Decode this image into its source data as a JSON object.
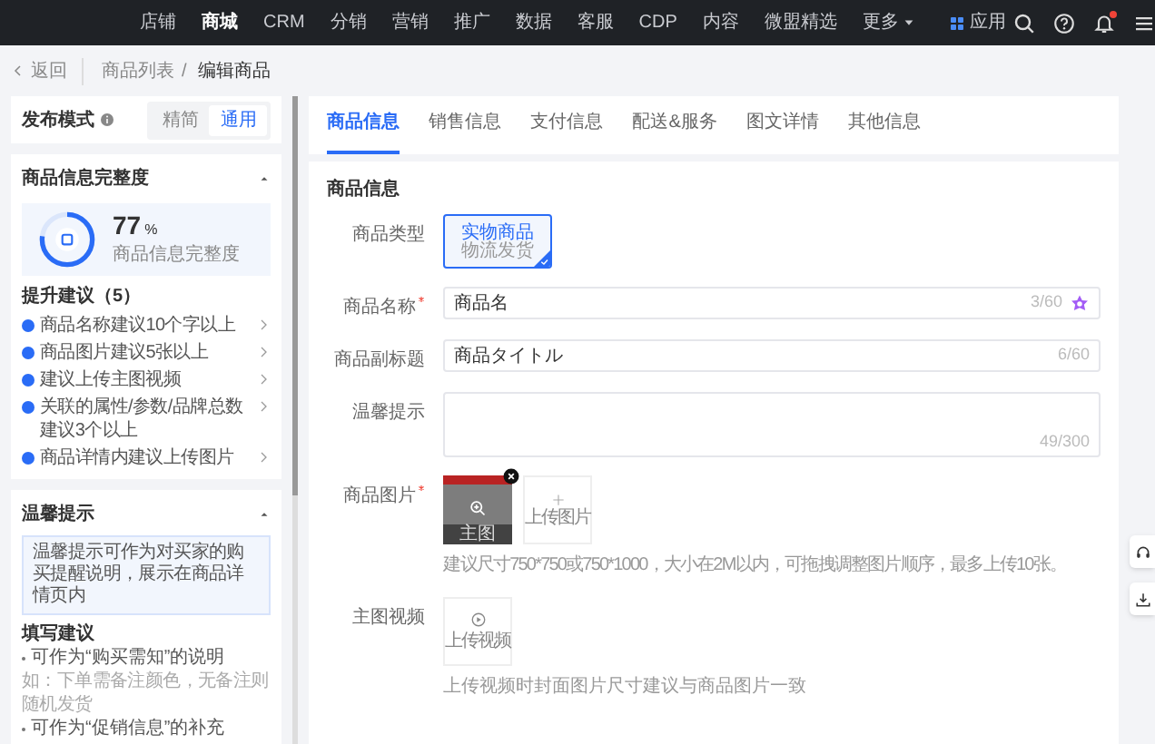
{
  "nav": {
    "items": [
      {
        "label": "店铺",
        "selected": false
      },
      {
        "label": "商城",
        "selected": true
      },
      {
        "label": "CRM",
        "selected": false
      },
      {
        "label": "分销",
        "selected": false
      },
      {
        "label": "营销",
        "selected": false
      },
      {
        "label": "推广",
        "selected": false
      },
      {
        "label": "数据",
        "selected": false
      },
      {
        "label": "客服",
        "selected": false
      },
      {
        "label": "CDP",
        "selected": false
      },
      {
        "label": "内容",
        "selected": false
      },
      {
        "label": "微盟精选",
        "selected": false
      }
    ],
    "more": "更多",
    "apps": "应用",
    "notification_dot": true
  },
  "breadcrumb": {
    "back": "返回",
    "separator": "/",
    "items": [
      "商品列表",
      "编辑商品"
    ]
  },
  "publish_mode": {
    "label": "发布模式",
    "options": [
      {
        "label": "精简",
        "selected": false
      },
      {
        "label": "通用",
        "selected": true
      }
    ]
  },
  "completeness": {
    "title": "商品信息完整度",
    "expanded": true,
    "percent": "77",
    "unit": "%",
    "caption": "商品信息完整度",
    "level": 0.77,
    "suggestions_title": "提升建议（5）",
    "suggestions": [
      "商品名称建议10个字以上",
      "商品图片建议5张以上",
      "建议上传主图视频",
      "关联的属性/参数/品牌总数建议3个以上",
      "商品详情内建议上传图片"
    ]
  },
  "tips": {
    "title": "温馨提示",
    "expanded": true,
    "notice": "温馨提示可作为对买家的购买提醒说明，展示在商品详情页内",
    "guide_title": "填写建议",
    "lines": [
      {
        "kind": "bullet",
        "text": "可作为“购买需知”的说明"
      },
      {
        "kind": "example",
        "text": "如：下单需备注颜色，无备注则随机发货"
      },
      {
        "kind": "bullet",
        "text": "可作为“促销信息”的补充"
      }
    ]
  },
  "tabs": [
    {
      "label": "商品信息",
      "selected": true
    },
    {
      "label": "销售信息",
      "selected": false
    },
    {
      "label": "支付信息",
      "selected": false
    },
    {
      "label": "配送&服务",
      "selected": false
    },
    {
      "label": "图文详情",
      "selected": false
    },
    {
      "label": "其他信息",
      "selected": false
    }
  ],
  "form": {
    "title": "商品信息",
    "fields": [
      {
        "kind": "type-card",
        "label": "商品类型",
        "required": false,
        "option": {
          "title": "实物商品",
          "subtitle": "物流发货",
          "selected": true
        }
      },
      {
        "kind": "text",
        "label": "商品名称",
        "required": true,
        "value": "商品名",
        "counter": "3/60",
        "ai_button": true
      },
      {
        "kind": "text",
        "label": "商品副标题",
        "required": false,
        "value": "商品タイトル",
        "counter": "6/60",
        "ai_button": false
      },
      {
        "kind": "textarea",
        "label": "温馨提示",
        "required": false,
        "counter": "49/300"
      },
      {
        "kind": "images",
        "label": "商品图片",
        "required": true,
        "image_caption": "主图",
        "upload_label": "上传图片",
        "hint": "建议尺寸750*750或750*1000，大小在2M以内，可拖拽调整图片顺序，最多上传10张。"
      },
      {
        "kind": "video",
        "label": "主图视频",
        "required": false,
        "upload_label": "上传视频",
        "hint": "上传视频时封面图片尺寸建议与商品图片一致"
      }
    ]
  }
}
